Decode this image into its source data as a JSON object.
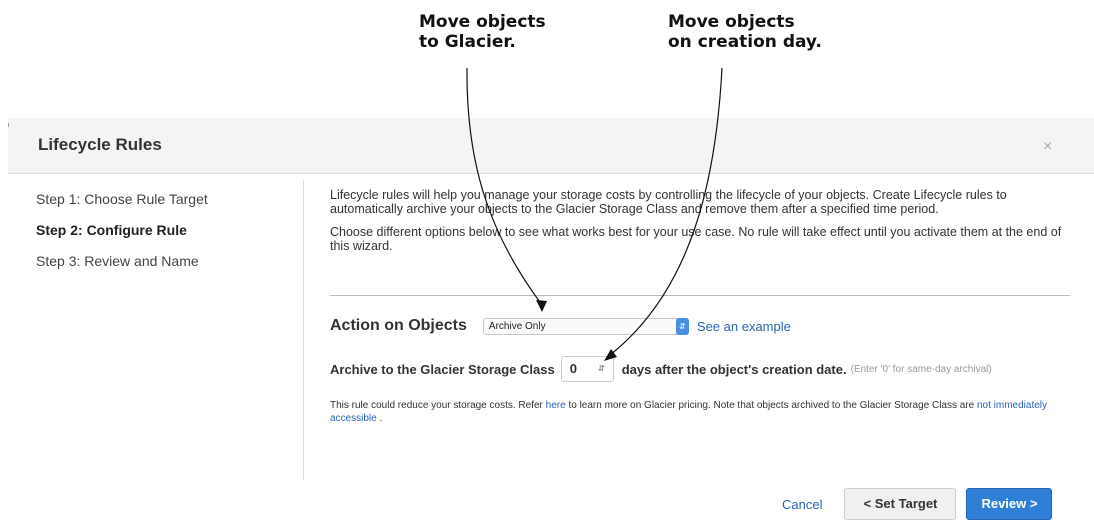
{
  "annotations": {
    "glacier": "Move objects\nto Glacier.",
    "creation_day": "Move objects\non creation day."
  },
  "dialog": {
    "title": "Lifecycle Rules",
    "close_glyph": "×"
  },
  "steps": [
    {
      "label": "Step 1: Choose Rule Target",
      "active": false
    },
    {
      "label": "Step 2: Configure Rule",
      "active": true
    },
    {
      "label": "Step 3: Review and Name",
      "active": false
    }
  ],
  "intro": {
    "paragraph1": "Lifecycle rules will help you manage your storage costs by controlling the lifecycle of your objects. Create Lifecycle rules to automatically archive your objects to the Glacier Storage Class and remove them after a specified time period.",
    "paragraph2": "Choose different options below to see what works best for your use case. No rule will take effect until you activate them at the end of this wizard."
  },
  "action": {
    "title": "Action on Objects",
    "selected_option": "Archive Only",
    "example_link": "See an example"
  },
  "archive": {
    "label": "Archive to the Glacier Storage Class",
    "days_value": "0",
    "days_suffix": "days after the object's creation date.",
    "hint": "(Enter '0' for same-day archival)"
  },
  "note": {
    "part1": "This rule could reduce your storage costs. Refer ",
    "here_link": "here",
    "part2": " to learn more on Glacier pricing. Note that objects archived to the Glacier Storage Class are ",
    "access_link": "not immediately accessible",
    "part3": " ."
  },
  "footer": {
    "cancel_label": "Cancel",
    "set_target_label": "< Set Target",
    "review_label": "Review >"
  },
  "colors": {
    "link": "#2a63b7",
    "primary_button": "#2f7fd6",
    "select_arrow": "#4a8ee4"
  }
}
